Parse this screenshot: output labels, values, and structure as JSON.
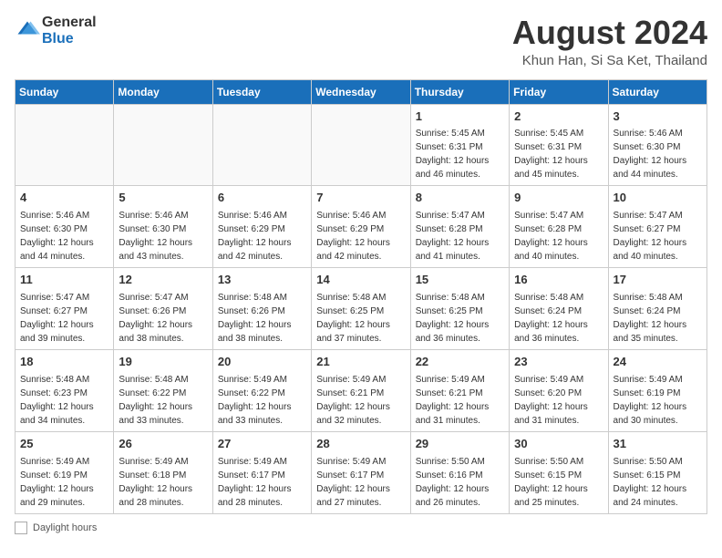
{
  "header": {
    "logo_general": "General",
    "logo_blue": "Blue",
    "title": "August 2024",
    "subtitle": "Khun Han, Si Sa Ket, Thailand"
  },
  "weekdays": [
    "Sunday",
    "Monday",
    "Tuesday",
    "Wednesday",
    "Thursday",
    "Friday",
    "Saturday"
  ],
  "weeks": [
    [
      {
        "day": "",
        "info": ""
      },
      {
        "day": "",
        "info": ""
      },
      {
        "day": "",
        "info": ""
      },
      {
        "day": "",
        "info": ""
      },
      {
        "day": "1",
        "info": "Sunrise: 5:45 AM\nSunset: 6:31 PM\nDaylight: 12 hours\nand 46 minutes."
      },
      {
        "day": "2",
        "info": "Sunrise: 5:45 AM\nSunset: 6:31 PM\nDaylight: 12 hours\nand 45 minutes."
      },
      {
        "day": "3",
        "info": "Sunrise: 5:46 AM\nSunset: 6:30 PM\nDaylight: 12 hours\nand 44 minutes."
      }
    ],
    [
      {
        "day": "4",
        "info": "Sunrise: 5:46 AM\nSunset: 6:30 PM\nDaylight: 12 hours\nand 44 minutes."
      },
      {
        "day": "5",
        "info": "Sunrise: 5:46 AM\nSunset: 6:30 PM\nDaylight: 12 hours\nand 43 minutes."
      },
      {
        "day": "6",
        "info": "Sunrise: 5:46 AM\nSunset: 6:29 PM\nDaylight: 12 hours\nand 42 minutes."
      },
      {
        "day": "7",
        "info": "Sunrise: 5:46 AM\nSunset: 6:29 PM\nDaylight: 12 hours\nand 42 minutes."
      },
      {
        "day": "8",
        "info": "Sunrise: 5:47 AM\nSunset: 6:28 PM\nDaylight: 12 hours\nand 41 minutes."
      },
      {
        "day": "9",
        "info": "Sunrise: 5:47 AM\nSunset: 6:28 PM\nDaylight: 12 hours\nand 40 minutes."
      },
      {
        "day": "10",
        "info": "Sunrise: 5:47 AM\nSunset: 6:27 PM\nDaylight: 12 hours\nand 40 minutes."
      }
    ],
    [
      {
        "day": "11",
        "info": "Sunrise: 5:47 AM\nSunset: 6:27 PM\nDaylight: 12 hours\nand 39 minutes."
      },
      {
        "day": "12",
        "info": "Sunrise: 5:47 AM\nSunset: 6:26 PM\nDaylight: 12 hours\nand 38 minutes."
      },
      {
        "day": "13",
        "info": "Sunrise: 5:48 AM\nSunset: 6:26 PM\nDaylight: 12 hours\nand 38 minutes."
      },
      {
        "day": "14",
        "info": "Sunrise: 5:48 AM\nSunset: 6:25 PM\nDaylight: 12 hours\nand 37 minutes."
      },
      {
        "day": "15",
        "info": "Sunrise: 5:48 AM\nSunset: 6:25 PM\nDaylight: 12 hours\nand 36 minutes."
      },
      {
        "day": "16",
        "info": "Sunrise: 5:48 AM\nSunset: 6:24 PM\nDaylight: 12 hours\nand 36 minutes."
      },
      {
        "day": "17",
        "info": "Sunrise: 5:48 AM\nSunset: 6:24 PM\nDaylight: 12 hours\nand 35 minutes."
      }
    ],
    [
      {
        "day": "18",
        "info": "Sunrise: 5:48 AM\nSunset: 6:23 PM\nDaylight: 12 hours\nand 34 minutes."
      },
      {
        "day": "19",
        "info": "Sunrise: 5:48 AM\nSunset: 6:22 PM\nDaylight: 12 hours\nand 33 minutes."
      },
      {
        "day": "20",
        "info": "Sunrise: 5:49 AM\nSunset: 6:22 PM\nDaylight: 12 hours\nand 33 minutes."
      },
      {
        "day": "21",
        "info": "Sunrise: 5:49 AM\nSunset: 6:21 PM\nDaylight: 12 hours\nand 32 minutes."
      },
      {
        "day": "22",
        "info": "Sunrise: 5:49 AM\nSunset: 6:21 PM\nDaylight: 12 hours\nand 31 minutes."
      },
      {
        "day": "23",
        "info": "Sunrise: 5:49 AM\nSunset: 6:20 PM\nDaylight: 12 hours\nand 31 minutes."
      },
      {
        "day": "24",
        "info": "Sunrise: 5:49 AM\nSunset: 6:19 PM\nDaylight: 12 hours\nand 30 minutes."
      }
    ],
    [
      {
        "day": "25",
        "info": "Sunrise: 5:49 AM\nSunset: 6:19 PM\nDaylight: 12 hours\nand 29 minutes."
      },
      {
        "day": "26",
        "info": "Sunrise: 5:49 AM\nSunset: 6:18 PM\nDaylight: 12 hours\nand 28 minutes."
      },
      {
        "day": "27",
        "info": "Sunrise: 5:49 AM\nSunset: 6:17 PM\nDaylight: 12 hours\nand 28 minutes."
      },
      {
        "day": "28",
        "info": "Sunrise: 5:49 AM\nSunset: 6:17 PM\nDaylight: 12 hours\nand 27 minutes."
      },
      {
        "day": "29",
        "info": "Sunrise: 5:50 AM\nSunset: 6:16 PM\nDaylight: 12 hours\nand 26 minutes."
      },
      {
        "day": "30",
        "info": "Sunrise: 5:50 AM\nSunset: 6:15 PM\nDaylight: 12 hours\nand 25 minutes."
      },
      {
        "day": "31",
        "info": "Sunrise: 5:50 AM\nSunset: 6:15 PM\nDaylight: 12 hours\nand 24 minutes."
      }
    ]
  ],
  "legend": {
    "label": "Daylight hours"
  }
}
